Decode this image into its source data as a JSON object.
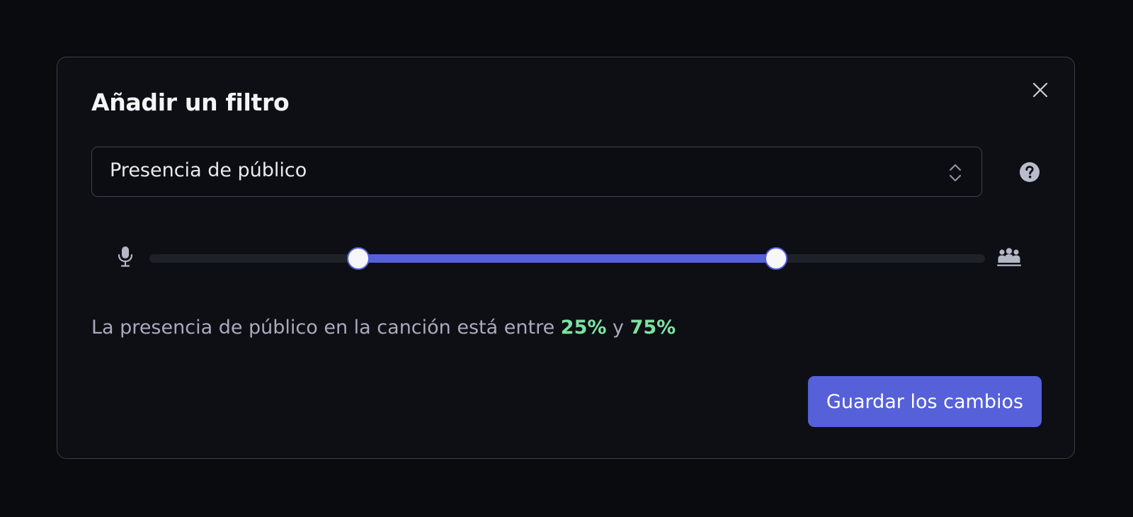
{
  "dialog": {
    "title": "Añadir un filtro",
    "close_icon": "close-icon",
    "help_icon": "question-circle-icon"
  },
  "filter_select": {
    "selected": "Presencia de público",
    "icon": "chevron-up-down-icon"
  },
  "range": {
    "min_icon": "microphone-icon",
    "max_icon": "audience-icon",
    "low": 0.25,
    "high": 0.75,
    "track_color": "#1f2129",
    "fill_color": "#5660d8"
  },
  "summary": {
    "prefix": "La presencia de público en la canción está entre",
    "low_label": "25%",
    "conjunction": "y",
    "high_label": "75%",
    "value_color": "#7ee2a0"
  },
  "actions": {
    "save_label": "Guardar los cambios",
    "accent": "#5660d8"
  }
}
